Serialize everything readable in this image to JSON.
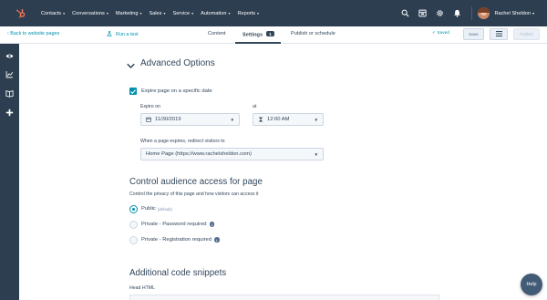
{
  "nav": {
    "items": [
      "Contacts",
      "Conversations",
      "Marketing",
      "Sales",
      "Service",
      "Automation",
      "Reports"
    ],
    "user_name": "Rachel Sheldon"
  },
  "editor": {
    "back_label": "Back to website pages",
    "run_test_label": "Run a test",
    "tabs": {
      "content": "Content",
      "settings": "Settings",
      "settings_badge": "1",
      "publish": "Publish or schedule"
    },
    "saved_label": "Saved",
    "save_label": "Save",
    "publish_label": "Publish"
  },
  "advanced": {
    "title": "Advanced Options",
    "expire_checkbox_label": "Expire page on a specific date",
    "expire_checked": true,
    "expire_on_label": "Expire on",
    "expire_date": "11/30/2019",
    "at_label": "at",
    "expire_time": "12:00 AM",
    "redirect_label": "When a page expires, redirect visitors to",
    "redirect_value": "Home Page (https://www.rachelsheldon.com)"
  },
  "audience": {
    "title": "Control audience access for page",
    "description": "Control the privacy of this page and how visitors can access it",
    "options": [
      {
        "label": "Public",
        "note": "(default)",
        "selected": true
      },
      {
        "label": "Private - Password required",
        "selected": false
      },
      {
        "label": "Private - Registration required",
        "selected": false
      }
    ]
  },
  "snippets": {
    "title": "Additional code snippets",
    "head_label": "Head HTML"
  },
  "help_label": "Help",
  "colors": {
    "nav_bg": "#2d3e50",
    "accent": "#0091ae",
    "text": "#33475b",
    "logo": "#ff7a59"
  }
}
